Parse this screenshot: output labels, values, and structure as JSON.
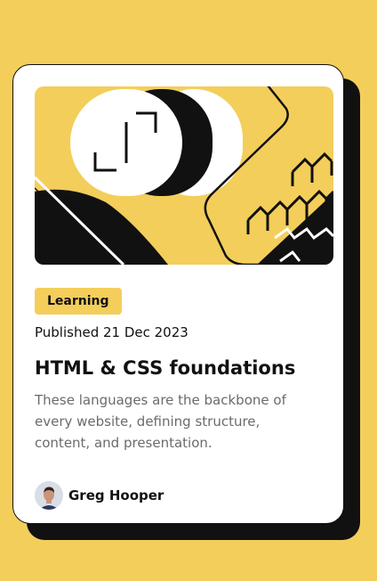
{
  "colors": {
    "background": "#F4CE5B",
    "card": "#FFFFFF",
    "ink": "#111111",
    "body_text": "#6B6B6B",
    "tag_background": "#F4CE5B"
  },
  "card": {
    "hero_image": "abstract-geometric-illustration",
    "tag": "Learning",
    "published": "Published 21 Dec 2023",
    "title": "HTML & CSS foundations",
    "description": "These languages are the backbone of every website, defining structure, content, and presentation.",
    "author": {
      "name": "Greg Hooper",
      "avatar": "avatar-photo"
    }
  }
}
